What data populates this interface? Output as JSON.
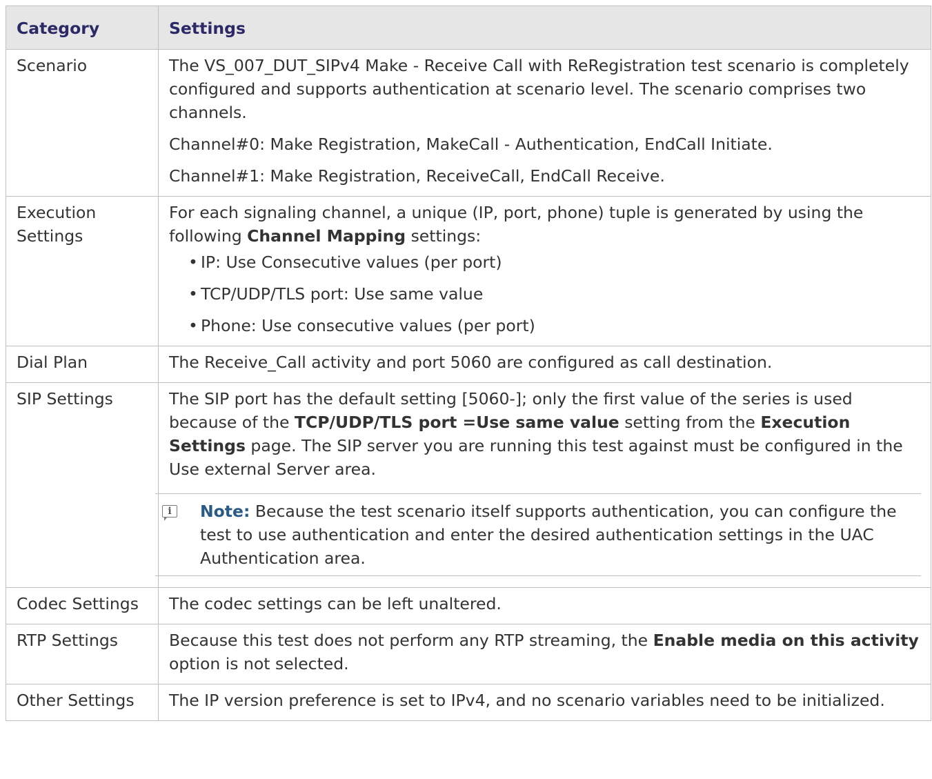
{
  "table": {
    "headers": {
      "category": "Category",
      "settings": "Settings"
    },
    "rows": {
      "scenario": {
        "category": "Scenario",
        "p1": "The VS_007_DUT_SIPv4 Make - Receive Call with ReRegistration test scenario is completely configured and supports authentication at scenario level. The scenario comprises two channels.",
        "p2": "Channel#0: Make Registration, MakeCall - Authentication, EndCall Initiate.",
        "p3": "Channel#1: Make Registration, ReceiveCall, EndCall Receive."
      },
      "execution": {
        "category": "Execution Settings",
        "intro_a": "For each signaling channel, a unique (IP, port, phone) tuple is generated by using the following ",
        "intro_bold": "Channel Mapping",
        "intro_b": " settings:",
        "bullets": [
          "IP: Use Consecutive values (per port)",
          "TCP/UDP/TLS port: Use same value",
          "Phone: Use consecutive values (per port)"
        ]
      },
      "dial_plan": {
        "category": "Dial Plan",
        "text": "The Receive_Call activity and port 5060 are configured as call destination."
      },
      "sip": {
        "category": "SIP Settings",
        "text_a": "The SIP port has the default setting [5060-]; only the first value of the series is used because of the ",
        "bold_1": "TCP/UDP/TLS port =Use same value",
        "text_b": " setting from the ",
        "bold_2": "Execution Settings",
        "text_c": " page. The SIP server you are running this test against must be configured in the Use external Server area.",
        "note_label": "Note:",
        "note_text": " Because the test scenario itself supports authentication, you can configure the test to use authentication and enter the desired authentication settings in the UAC Authentication area."
      },
      "codec": {
        "category": "Codec Settings",
        "text": "The codec settings can be left unaltered."
      },
      "rtp": {
        "category": "RTP Settings",
        "text_a": "Because this test does not perform any RTP streaming, the ",
        "bold": "Enable media on this activity",
        "text_b": " option is not selected."
      },
      "other": {
        "category": "Other Settings",
        "text": "The IP version preference is set to IPv4, and no scenario variables need to be initialized."
      }
    }
  }
}
